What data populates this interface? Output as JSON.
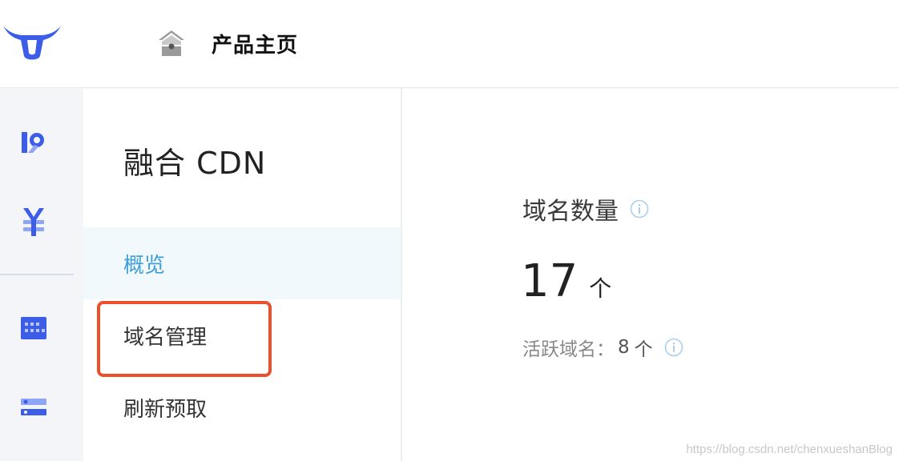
{
  "header": {
    "home_label": "产品主页",
    "logo_icon": "bull-logo-icon",
    "home_icon": "home-icon"
  },
  "rail": {
    "items": [
      {
        "icon": "kodo-icon"
      },
      {
        "icon": "yen-icon"
      },
      {
        "icon": "grid-app-icon"
      },
      {
        "icon": "server-icon"
      }
    ]
  },
  "subnav": {
    "title": "融合 CDN",
    "items": [
      {
        "label": "概览",
        "active": true
      },
      {
        "label": "域名管理",
        "active": false
      },
      {
        "label": "刷新预取",
        "active": false
      }
    ]
  },
  "main": {
    "stat_label": "域名数量",
    "stat_value": "17",
    "stat_unit": "个",
    "sub_label": "活跃域名：",
    "sub_value": "8",
    "sub_unit": "个"
  },
  "watermark": "https://blog.csdn.net/chenxueshanBlog",
  "colors": {
    "accent": "#3f9fd8",
    "rail_icon": "#3b5de7",
    "highlight": "#e9502b",
    "active_bg": "#f2f9fd"
  }
}
